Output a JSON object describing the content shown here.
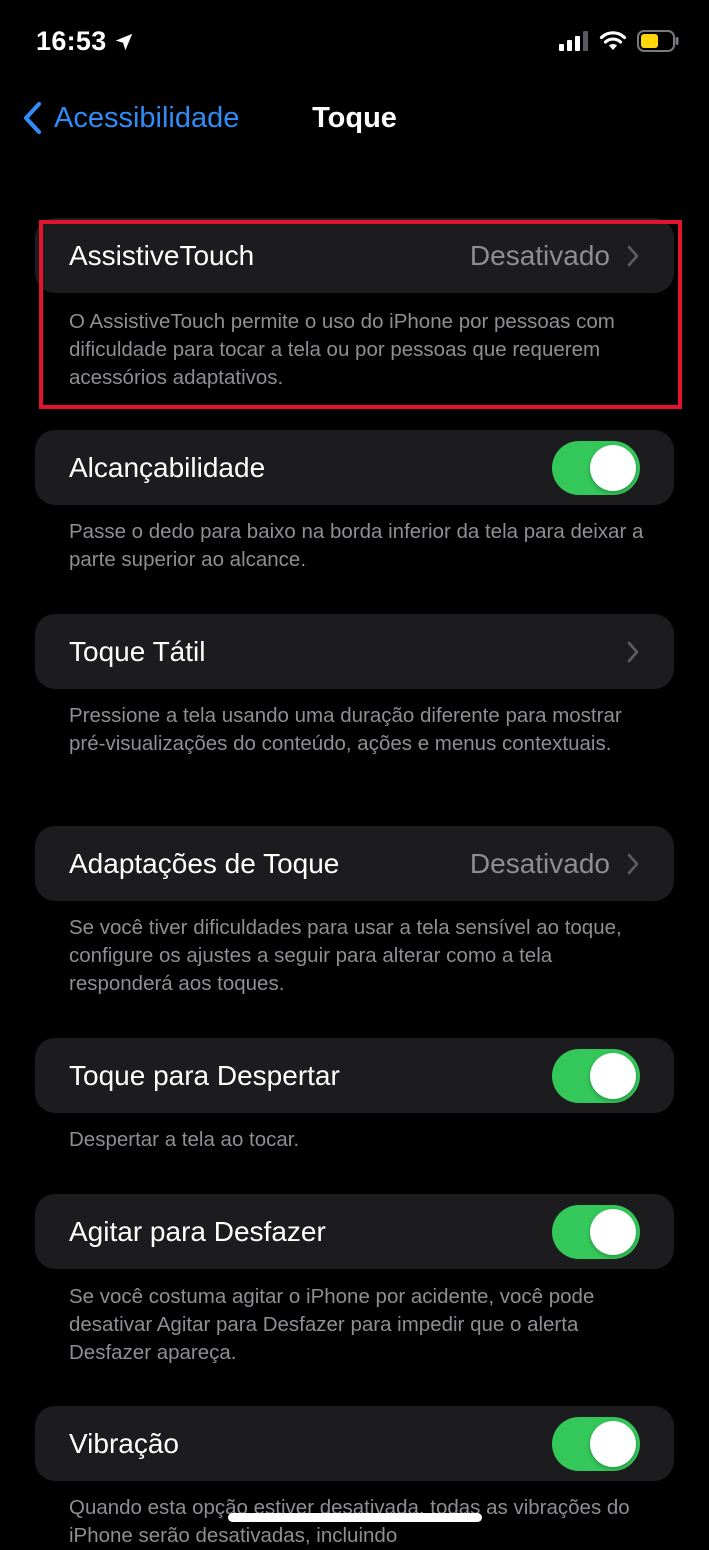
{
  "status_bar": {
    "time": "16:53",
    "battery_color": "#ffd60a"
  },
  "nav": {
    "back_label": "Acessibilidade",
    "title": "Toque"
  },
  "colors": {
    "accent": "#2f8cf6",
    "toggle_on": "#34c759",
    "highlight": "#e2142d"
  },
  "settings": {
    "assistive_touch": {
      "label": "AssistiveTouch",
      "value": "Desativado",
      "footer": "O AssistiveTouch permite o uso do iPhone por pessoas com dificuldade para tocar a tela ou por pessoas que requerem acessórios adaptativos."
    },
    "reachability": {
      "label": "Alcançabilidade",
      "on": true,
      "footer": "Passe o dedo para baixo na borda inferior da tela para deixar a parte superior ao alcance."
    },
    "haptic_touch": {
      "label": "Toque Tátil",
      "footer": "Pressione a tela usando uma duração diferente para mostrar pré-visualizações do conteúdo, ações e menus contextuais."
    },
    "touch_accommodations": {
      "label": "Adaptações de Toque",
      "value": "Desativado",
      "footer": "Se você tiver dificuldades para usar a tela sensível ao toque, configure os ajustes a seguir para alterar como a tela responderá aos toques."
    },
    "tap_to_wake": {
      "label": "Toque para Despertar",
      "on": true,
      "footer": "Despertar a tela ao tocar."
    },
    "shake_to_undo": {
      "label": "Agitar para Desfazer",
      "on": true,
      "footer": "Se você costuma agitar o iPhone por acidente, você pode desativar Agitar para Desfazer para impedir que o alerta Desfazer apareça."
    },
    "vibration": {
      "label": "Vibração",
      "on": true,
      "footer": "Quando esta opção estiver desativada, todas as vibrações do iPhone serão desativadas, incluindo"
    }
  }
}
